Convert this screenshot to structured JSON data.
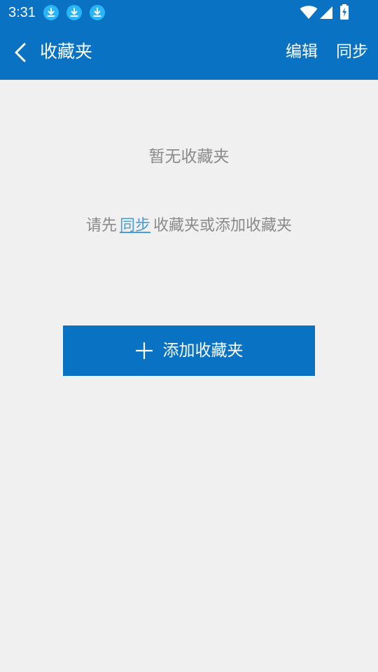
{
  "status_bar": {
    "time": "3:31",
    "icons": [
      "download-icon",
      "download-icon",
      "download-icon",
      "wifi-icon",
      "signal-icon",
      "battery-charging-icon"
    ]
  },
  "app_bar": {
    "title": "收藏夹",
    "back_icon": "back-arrow-icon",
    "actions": [
      "编辑",
      "同步"
    ]
  },
  "empty_state": {
    "title": "暂无收藏夹",
    "hint_prefix": "请先",
    "hint_link": "同步",
    "hint_suffix": "收藏夹或添加收藏夹"
  },
  "add_button": {
    "icon": "plus-icon",
    "label": "添加收藏夹"
  },
  "colors": {
    "primary": "#0a72c2",
    "background": "#f0f0f0",
    "muted_text": "#8a8a8a",
    "link": "#4a9bd8"
  }
}
